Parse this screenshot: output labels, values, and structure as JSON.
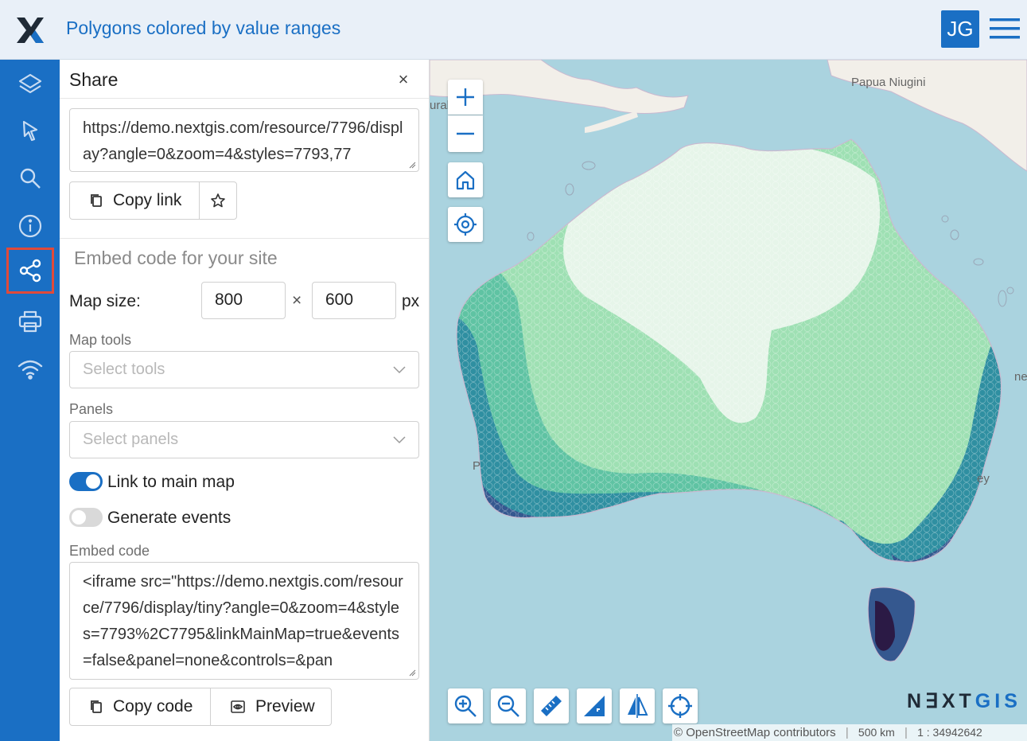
{
  "header": {
    "title": "Polygons colored by value ranges",
    "avatar_initials": "JG",
    "accent_color": "#1a6fc4"
  },
  "sidebar": {
    "items": [
      {
        "name": "layers-icon"
      },
      {
        "name": "select-icon"
      },
      {
        "name": "search-icon"
      },
      {
        "name": "info-icon"
      },
      {
        "name": "share-icon",
        "active": true
      },
      {
        "name": "print-icon"
      },
      {
        "name": "wifi-icon"
      }
    ]
  },
  "share": {
    "title": "Share",
    "close_label": "×",
    "link_url": "https://demo.nextgis.com/resource/7796/display?angle=0&zoom=4&styles=7793,77",
    "copy_link_label": "Copy link",
    "embed_title": "Embed code for your site",
    "map_size_label": "Map size:",
    "width_value": "800",
    "height_value": "600",
    "size_separator": "×",
    "size_unit": "px",
    "map_tools_label": "Map tools",
    "map_tools_placeholder": "Select tools",
    "panels_label": "Panels",
    "panels_placeholder": "Select panels",
    "link_main_map_label": "Link to main map",
    "link_main_map_on": true,
    "generate_events_label": "Generate events",
    "generate_events_on": false,
    "embed_code_label": "Embed code",
    "embed_code": "<iframe src=\"https://demo.nextgis.com/resource/7796/display/tiny?angle=0&zoom=4&styles=7793%2C7795&linkMainMap=true&events=false&panel=none&controls=&pan",
    "copy_code_label": "Copy code",
    "preview_label": "Preview"
  },
  "map": {
    "labels": {
      "papua": "Papua Niugini",
      "left_edge": "ural",
      "right_edge_1": "ne",
      "right_edge_2": "ey",
      "left_p": "P"
    },
    "attribution": "© OpenStreetMap contributors",
    "scale": "500 km",
    "ratio": "1 : 34942642",
    "brand_a": "N∃XT",
    "brand_b": "GIS",
    "colors": {
      "water": "#aad3df",
      "land": "#f2efe9",
      "class1": "#e6f5e9",
      "class2": "#9ee0b3",
      "class3": "#5fc3a3",
      "class4": "#2f8fa1",
      "class5": "#35588f",
      "class6": "#2b1a45"
    }
  }
}
